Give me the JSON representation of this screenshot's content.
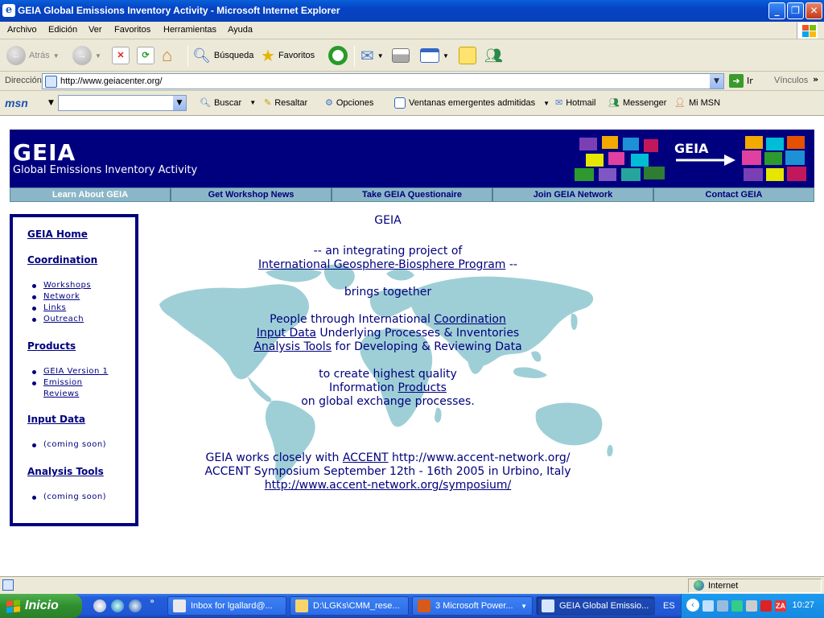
{
  "window": {
    "title": "GEIA Global Emissions Inventory Activity - Microsoft Internet Explorer",
    "app_icon": "ie-icon",
    "controls": [
      "minimize",
      "restore",
      "close"
    ]
  },
  "menubar": [
    "Archivo",
    "Edición",
    "Ver",
    "Favoritos",
    "Herramientas",
    "Ayuda"
  ],
  "toolbar": {
    "back_label": "Atrás",
    "search_label": "Búsqueda",
    "favorites_label": "Favoritos"
  },
  "addressbar": {
    "label": "Dirección",
    "url": "http://www.geiacenter.org/",
    "go_label": "Ir",
    "links_label": "Vínculos",
    "more": "»"
  },
  "msnbar": {
    "logo": "msn",
    "search_value": "",
    "buscar_label": "Buscar",
    "resaltar_label": "Resaltar",
    "opciones_label": "Opciones",
    "popups_label": "Ventanas emergentes admitidas",
    "hotmail_label": "Hotmail",
    "messenger_label": "Messenger",
    "mimsn_label": "Mi MSN"
  },
  "page": {
    "banner": {
      "title": "GEIA",
      "subtitle": "Global Emissions Inventory Activity",
      "puzzle_label": "GEIA"
    },
    "nav": [
      "Learn About GEIA",
      "Get Workshop News",
      "Take GEIA Questionaire",
      "Join GEIA Network",
      "Contact GEIA"
    ],
    "sidebar": {
      "home": "GEIA Home",
      "coordination": "Coordination",
      "coordination_items": [
        "Workshops",
        "Network",
        "Links",
        "Outreach"
      ],
      "products": "Products",
      "products_items": [
        "GEIA Version 1",
        "Emission",
        "Reviews"
      ],
      "input_data": "Input Data",
      "input_items": [
        "(coming soon)"
      ],
      "analysis_tools": "Analysis Tools",
      "analysis_items": [
        "(coming soon)"
      ]
    },
    "content": {
      "heading": "GEIA",
      "line1": "-- an integrating project of",
      "igbp_link": "International Geosphere-Biosphere Program",
      "igbp_suffix": " --",
      "brings": "brings together",
      "people_prefix": "People through International ",
      "coordination_link": "Coordination",
      "input_link": "Input Data",
      "input_suffix": " Underlying Processes & Inventories",
      "analysis_link": "Analysis Tools",
      "analysis_suffix": " for Developing & Reviewing Data",
      "create": "to create highest quality",
      "info_prefix": "Information ",
      "products_link": "Products",
      "global": "on global exchange processes.",
      "works_prefix": "GEIA works closely with ",
      "accent_link": "ACCENT",
      "works_suffix": " http://www.accent-network.org/",
      "symposium": "ACCENT Symposium September 12th - 16th 2005 in Urbino, Italy",
      "symposium_link": "http://www.accent-network.org/symposium/"
    }
  },
  "statusbar": {
    "zone": "Internet"
  },
  "taskbar": {
    "start": "Inicio",
    "tasks": [
      "Inbox for lgallard@...",
      "D:\\LGKs\\CMM_rese...",
      "3 Microsoft Power...",
      "GEIA Global Emissio..."
    ],
    "language": "ES",
    "clock": "10:27"
  },
  "colors": {
    "geia_navy": "#00007e",
    "nav_teal": "#8bb6c7",
    "map_color": "#9fcfd6"
  }
}
